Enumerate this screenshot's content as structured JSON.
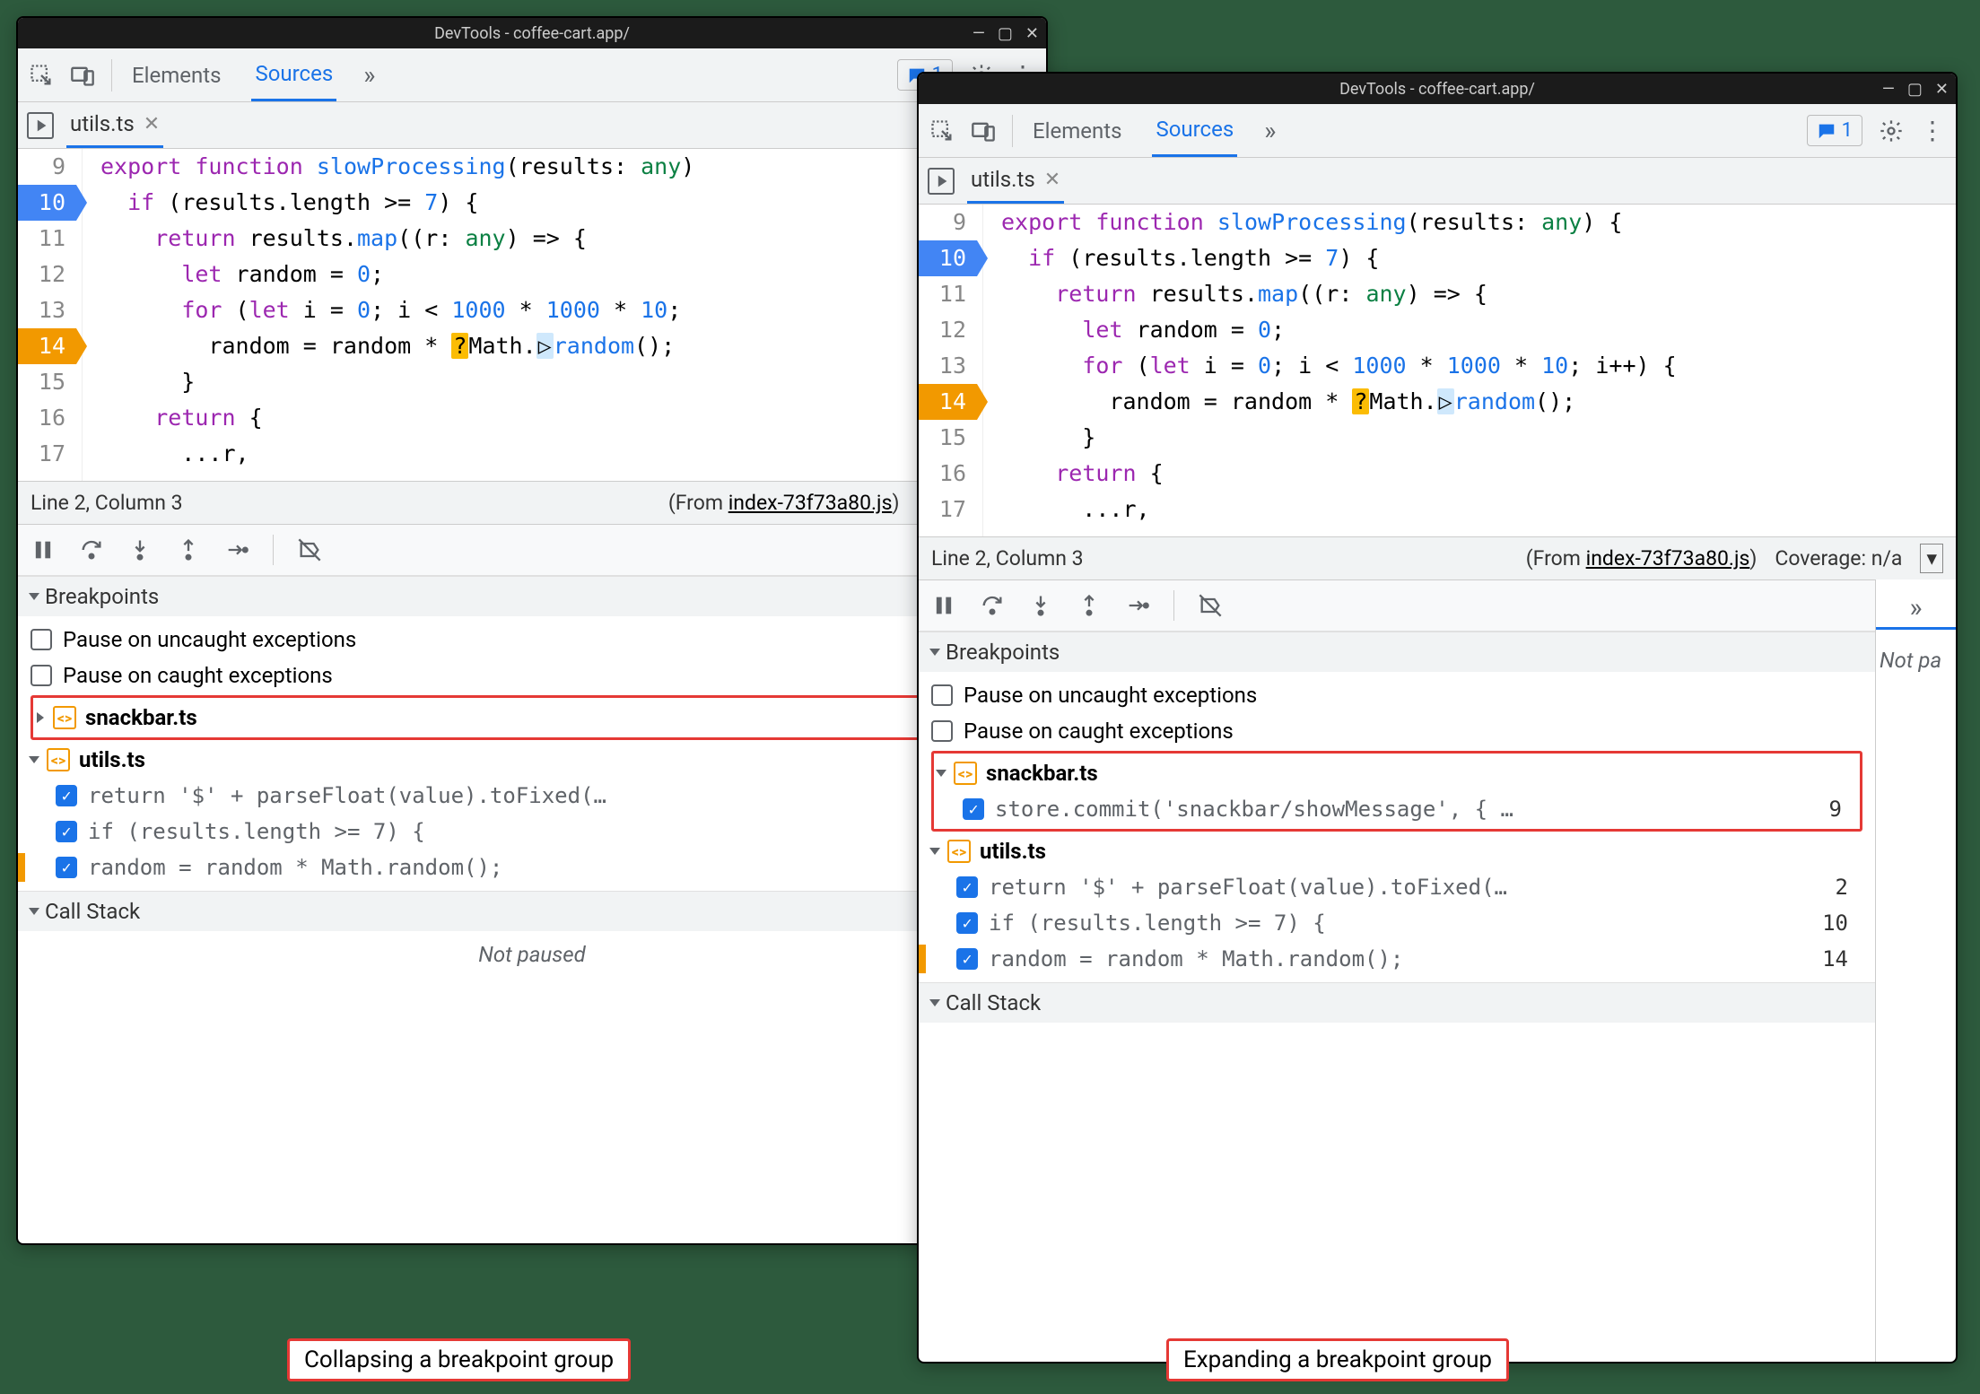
{
  "windowTitle": "DevTools - coffee-cart.app/",
  "toolbar": {
    "tabs": {
      "elements": "Elements",
      "sources": "Sources"
    },
    "issueCount": "1"
  },
  "file": {
    "name": "utils.ts"
  },
  "code": {
    "lines": [
      "9",
      "10",
      "11",
      "12",
      "13",
      "14",
      "15",
      "16",
      "17"
    ]
  },
  "status": {
    "position": "Line 2, Column 3",
    "fromLabel": "(From ",
    "fromFile": "index-73f73a80.js",
    "fromClose": ")",
    "coverageA": "Coverage: n/",
    "coverageB": "Coverage: n/a"
  },
  "breakpointsPane": {
    "title": "Breakpoints",
    "pauseUncaught": "Pause on uncaught exceptions",
    "pauseCaught": "Pause on caught exceptions",
    "groups": {
      "snackbar": "snackbar.ts",
      "utils": "utils.ts"
    },
    "items": {
      "snackbar1": {
        "text": "store.commit('snackbar/showMessage', { …",
        "line": "9"
      },
      "utils1": {
        "text": "return '$' + parseFloat(value).toFixed(…",
        "line": "2"
      },
      "utils2": {
        "text": "if (results.length >= 7) {",
        "line": "10"
      },
      "utils3": {
        "text": "random = random * Math.random();",
        "line": "14"
      }
    }
  },
  "callStack": {
    "title": "Call Stack",
    "notPaused": "Not paused"
  },
  "sidePanel": {
    "notPaused": "Not pa"
  },
  "captions": {
    "left": "Collapsing a breakpoint group",
    "right": "Expanding a breakpoint group"
  }
}
